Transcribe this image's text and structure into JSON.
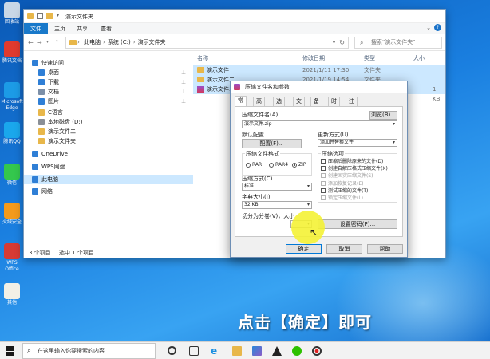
{
  "desktop_icons": [
    {
      "label": "回收站",
      "icon": "recycle-bin-icon",
      "color": "#c9d7e6"
    },
    {
      "label": "腾讯文档",
      "icon": "tencent-doc-icon",
      "color": "#e03a2e"
    },
    {
      "label": "Microsoft Edge",
      "icon": "edge-icon",
      "color": "#1c9be6"
    },
    {
      "label": "腾讯QQ",
      "icon": "qq-icon",
      "color": "#1aa7ec"
    },
    {
      "label": "微信",
      "icon": "wechat-icon",
      "color": "#34c74d"
    },
    {
      "label": "火绒安全",
      "icon": "huorong-icon",
      "color": "#f39a1c"
    },
    {
      "label": "WPS Office",
      "icon": "wps-icon",
      "color": "#d63a34"
    },
    {
      "label": "其他",
      "icon": "file-icon",
      "color": "#f2f0e6"
    }
  ],
  "explorer": {
    "title": "演示文件夹",
    "ribbon_tabs": [
      "文件",
      "主页",
      "共享",
      "查看"
    ],
    "address": [
      "此电脑",
      "系统 (C:)",
      "演示文件夹"
    ],
    "search_placeholder": "搜索\"演示文件夹\"",
    "nav": [
      {
        "label": "快速访问",
        "icon": "star-icon",
        "pinned": false,
        "level": 0
      },
      {
        "label": "桌面",
        "icon": "desktop-icon",
        "pinned": true,
        "level": 1
      },
      {
        "label": "下载",
        "icon": "download-icon",
        "pinned": true,
        "level": 1
      },
      {
        "label": "文档",
        "icon": "document-icon",
        "pinned": true,
        "level": 1
      },
      {
        "label": "图片",
        "icon": "picture-icon",
        "pinned": true,
        "level": 1
      },
      {
        "label": "C语言",
        "icon": "folder-icon",
        "pinned": false,
        "level": 1
      },
      {
        "label": "本地磁盘 (D:)",
        "icon": "drive-icon",
        "pinned": false,
        "level": 1
      },
      {
        "label": "演示文件二",
        "icon": "folder-icon",
        "pinned": false,
        "level": 1
      },
      {
        "label": "演示文件夹",
        "icon": "folder-icon",
        "pinned": false,
        "level": 1
      },
      {
        "label": "OneDrive",
        "icon": "cloud-icon",
        "pinned": false,
        "level": 0
      },
      {
        "label": "WPS网盘",
        "icon": "cloud-icon",
        "pinned": false,
        "level": 0
      },
      {
        "label": "此电脑",
        "icon": "computer-icon",
        "pinned": false,
        "level": 0,
        "selected": true
      },
      {
        "label": "网络",
        "icon": "network-icon",
        "pinned": false,
        "level": 0
      }
    ],
    "columns": {
      "name": "名称",
      "modified": "修改日期",
      "type": "类型",
      "size": "大小"
    },
    "files": [
      {
        "name": "演示文件",
        "modified": "2021/1/11 17:30",
        "type": "文件夹",
        "size": "",
        "selected": true
      },
      {
        "name": "演示文件二",
        "modified": "2021/1/19 14:54",
        "type": "文件夹",
        "size": "",
        "selected": true
      },
      {
        "name": "演示文件.rar",
        "modified": "",
        "type": "",
        "size": "1 KB",
        "selected": true
      }
    ],
    "status": {
      "count": "3 个项目",
      "selected": "选中 1 个项目"
    }
  },
  "dialog": {
    "title": "压缩文件名和参数",
    "tabs": [
      "常规",
      "高级",
      "选项",
      "文件",
      "备份",
      "时间",
      "注释"
    ],
    "archive_name_label": "压缩文件名(A)",
    "archive_name": "演示文件.zip",
    "browse": "浏览(B)...",
    "default_profile_label": "默认配置",
    "profiles_button": "配置(F)...",
    "update_mode_label": "更新方式(U)",
    "update_mode": "添加并替换文件",
    "format_label": "压缩文件格式",
    "formats": [
      {
        "label": "RAR",
        "on": false
      },
      {
        "label": "RAR4",
        "on": false
      },
      {
        "label": "ZIP",
        "on": true
      }
    ],
    "method_label": "压缩方式(C)",
    "method": "标准",
    "dict_label": "字典大小(I)",
    "dict": "32 KB",
    "split_label": "切分为分卷(V)，大小",
    "options_label": "压缩选项",
    "options": [
      {
        "label": "压缩后删除原来的文件(D)",
        "on": false,
        "disabled": false
      },
      {
        "label": "创建自解压格式压缩文件(X)",
        "on": false,
        "disabled": false
      },
      {
        "label": "创建固实压缩文件(S)",
        "on": false,
        "disabled": true
      },
      {
        "label": "添加恢复记录(E)",
        "on": false,
        "disabled": true
      },
      {
        "label": "测试压缩的文件(T)",
        "on": false,
        "disabled": false
      },
      {
        "label": "锁定压缩文件(L)",
        "on": false,
        "disabled": true
      }
    ],
    "password_button": "设置密码(P)...",
    "ok": "确定",
    "cancel": "取消",
    "help": "帮助"
  },
  "caption": "点击【确定】即可",
  "taskbar": {
    "search_placeholder": "在这里输入你要搜索的内容"
  }
}
